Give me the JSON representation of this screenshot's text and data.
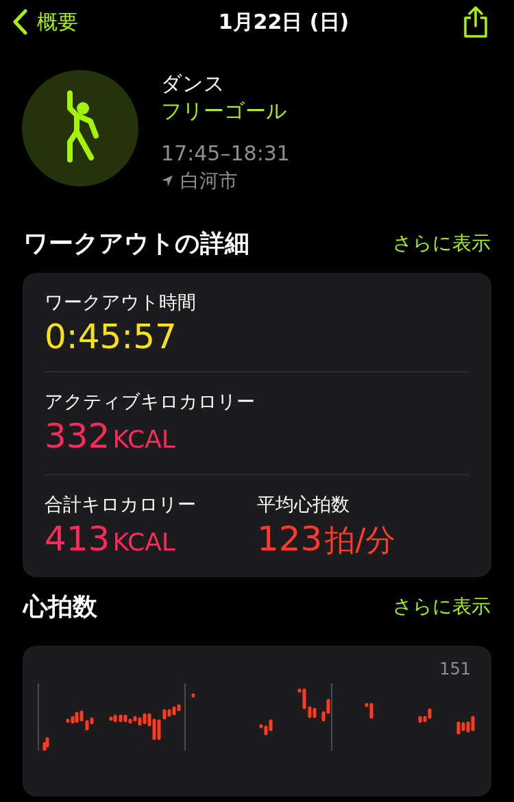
{
  "nav": {
    "back_label": "概要",
    "title": "1月22日 (日)"
  },
  "workout": {
    "type": "ダンス",
    "goal": "フリーゴール",
    "time": "17:45–18:31",
    "location": "白河市"
  },
  "details": {
    "heading": "ワークアウトの詳細",
    "more": "さらに表示",
    "metrics": [
      {
        "label": "ワークアウト時間",
        "value": "0:45:57",
        "color": "#f7e11f"
      },
      {
        "label": "アクティブキロカロリー",
        "value": "332",
        "unit": "KCAL",
        "color": "#fa2a5a"
      },
      {
        "label": "合計キロカロリー",
        "value": "413",
        "unit": "KCAL",
        "color": "#fa2a5a"
      },
      {
        "label": "平均心拍数",
        "value": "123",
        "unit": "拍/分",
        "color": "#ff3a2a"
      }
    ]
  },
  "heart_rate": {
    "heading": "心拍数",
    "more": "さらに表示",
    "max_label": "151"
  }
}
